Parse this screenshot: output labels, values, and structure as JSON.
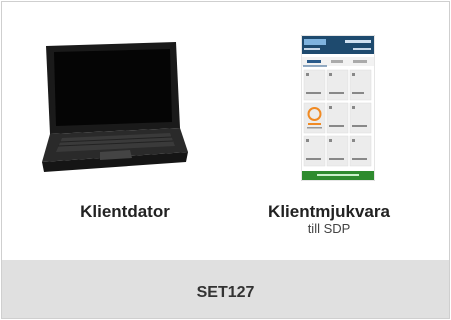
{
  "items": [
    {
      "label": "Klientdator",
      "icon": "laptop-image"
    },
    {
      "label": "Klientmjukvara",
      "sublabel": "till SDP",
      "icon": "app-screenshot-image"
    }
  ],
  "footer": {
    "label": "SET127"
  },
  "colors": {
    "panel_background": "#e0e0e0",
    "border": "#cfcfcf",
    "app_header": "#1e4a6e",
    "app_status_bar": "#2e8b2e"
  }
}
